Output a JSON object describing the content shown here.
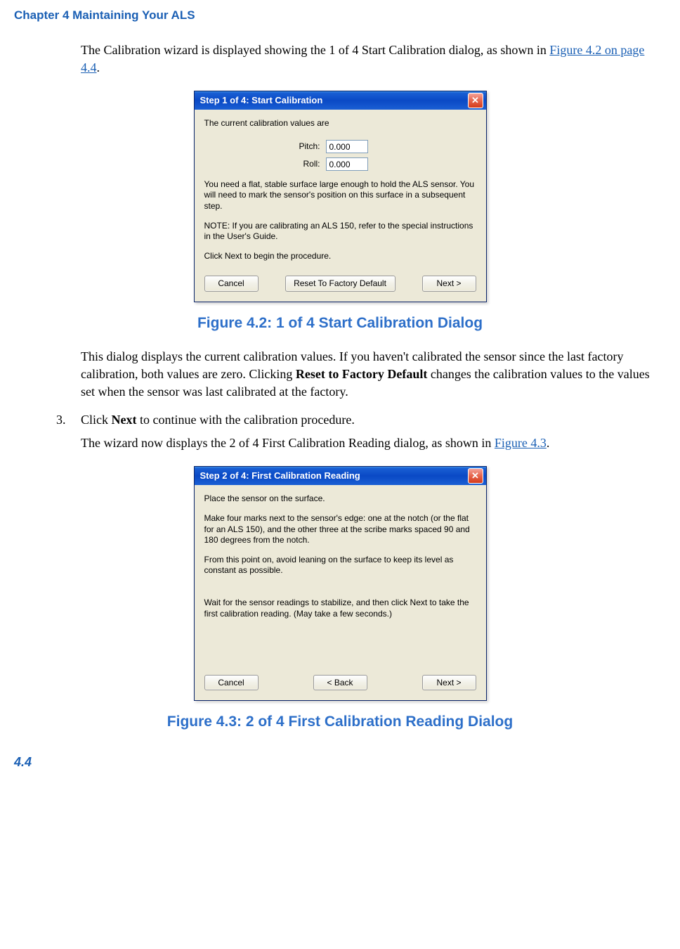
{
  "chapter_header": "Chapter 4  Maintaining Your ALS",
  "intro_p1a": "The Calibration wizard is displayed showing the 1 of 4 Start Calibration dialog, as shown in ",
  "intro_link1": "Figure 4.2 on page 4.4",
  "intro_p1b": ".",
  "dialog1": {
    "title": "Step 1 of 4:  Start Calibration",
    "line1": "The current calibration values are",
    "pitch_label": "Pitch:",
    "pitch_value": "0.000",
    "roll_label": "Roll:",
    "roll_value": "0.000",
    "line2": "You need a flat, stable surface large enough to hold the ALS sensor. You will need to mark the sensor's position on this surface in a subsequent step.",
    "line3": "NOTE:  If you are calibrating an ALS 150, refer to the special instructions in the User's Guide.",
    "line4": "Click Next to begin the procedure.",
    "btn_cancel": "Cancel",
    "btn_reset": "Reset To Factory Default",
    "btn_next": "Next >"
  },
  "caption1": "Figure 4.2: 1 of 4 Start Calibration Dialog",
  "para2a": "This dialog displays the current calibration values. If you haven't calibrated the sensor since the last factory calibration, both values are zero. Clicking ",
  "para2_bold": "Reset to Factory Default",
  "para2b": " changes the calibration values to the values set when the sensor was last calibrated at the factory.",
  "step3_num": "3.",
  "step3a": "Click ",
  "step3_bold": "Next",
  "step3b": " to continue with the calibration procedure.",
  "step3_p2a": "The wizard now displays the 2 of 4 First Calibration Reading dialog, as shown in ",
  "step3_link": "Figure 4.3",
  "step3_p2b": ".",
  "dialog2": {
    "title": "Step 2 of 4:  First Calibration Reading",
    "line1": "Place the sensor on the surface.",
    "line2": "Make four marks next to the sensor's edge:  one at the notch (or the flat for an ALS 150), and the other three at the scribe marks spaced 90 and 180 degrees from the notch.",
    "line3": "From this point on, avoid leaning on the surface to keep its level as constant as possible.",
    "line4": "Wait for the sensor readings to stabilize, and then click Next to take the first calibration reading. (May take a few seconds.)",
    "btn_cancel": "Cancel",
    "btn_back": "< Back",
    "btn_next": "Next >"
  },
  "caption2": "Figure 4.3: 2 of 4 First Calibration Reading Dialog",
  "page_number": "4.4"
}
